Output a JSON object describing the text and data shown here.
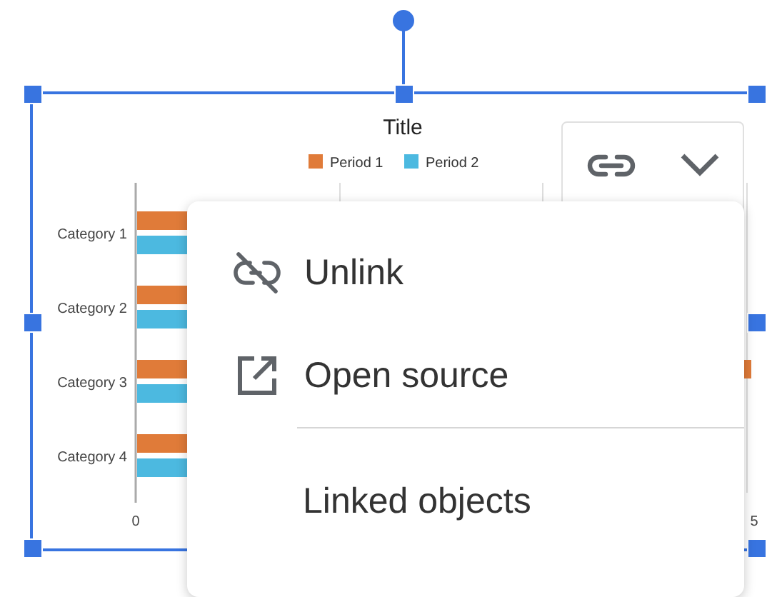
{
  "chart": {
    "selected": true,
    "title": "Title",
    "legend": [
      {
        "label": "Period 1",
        "color": "#e07b39"
      },
      {
        "label": "Period 2",
        "color": "#4cb9e0"
      }
    ],
    "categories": [
      "Category 1",
      "Category 2",
      "Category 3",
      "Category 4"
    ],
    "axis_labels": [
      "0",
      "5"
    ]
  },
  "toolbar": {
    "buttons": [
      {
        "kind": "link"
      },
      {
        "kind": "dropdown"
      }
    ]
  },
  "menu": {
    "items": [
      {
        "kind": "unlink",
        "label": "Unlink"
      },
      {
        "kind": "open",
        "label": "Open source"
      },
      {
        "kind": "divider"
      },
      {
        "kind": "plain",
        "label": "Linked objects"
      }
    ]
  }
}
